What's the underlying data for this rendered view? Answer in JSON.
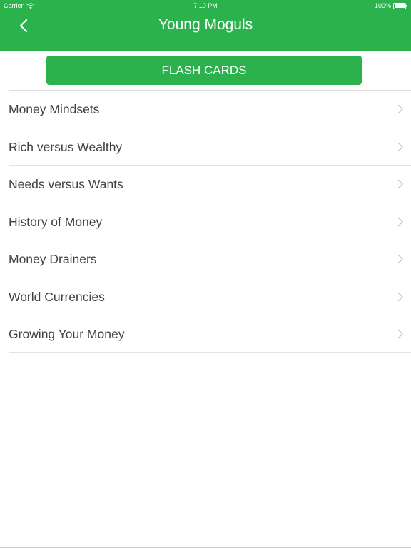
{
  "status_bar": {
    "carrier": "Carrier",
    "time": "7:10 PM",
    "battery": "100%"
  },
  "nav": {
    "title": "Young Moguls"
  },
  "flash_cards": {
    "label": "FLASH CARDS"
  },
  "menu": {
    "items": [
      {
        "label": "Money Mindsets"
      },
      {
        "label": "Rich versus Wealthy"
      },
      {
        "label": "Needs versus Wants"
      },
      {
        "label": "History of Money"
      },
      {
        "label": "Money Drainers"
      },
      {
        "label": "World Currencies"
      },
      {
        "label": "Growing Your Money"
      }
    ]
  },
  "colors": {
    "brand_green": "#2bb24c",
    "text": "#404040",
    "chevron": "#c7c7cc"
  },
  "icons": [
    "wifi-icon",
    "battery-icon",
    "back-chevron-icon",
    "chevron-right-icon"
  ]
}
